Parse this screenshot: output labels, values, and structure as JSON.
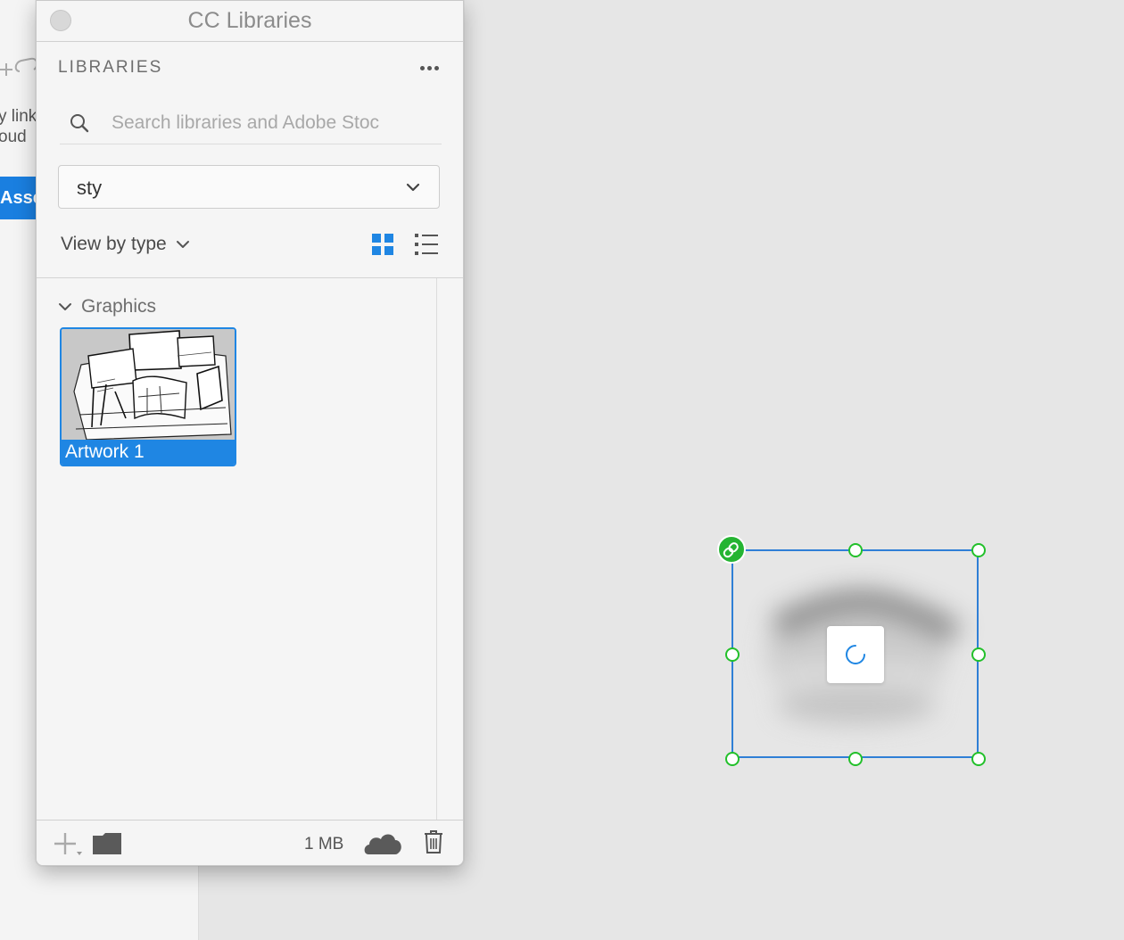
{
  "background_app": {
    "text_line_1": "y link",
    "text_line_2": "oud",
    "button_label": "Asse"
  },
  "panel": {
    "title": "CC Libraries",
    "header": "LIBRARIES",
    "search": {
      "placeholder": "Search libraries and Adobe Stoc",
      "value": ""
    },
    "library_select": {
      "selected": "sty"
    },
    "view_by_label": "View by type",
    "view_mode": "grid",
    "sections": [
      {
        "label": "Graphics",
        "expanded": true,
        "items": [
          {
            "label": "Artwork 1",
            "selected": true
          }
        ]
      }
    ],
    "footer": {
      "storage_used": "1 MB"
    }
  },
  "canvas": {
    "selection": {
      "linked": true,
      "loading": true
    }
  },
  "colors": {
    "accent": "#1f86e3",
    "handle": "#22c02a",
    "selection_border": "#2f7fd6"
  }
}
